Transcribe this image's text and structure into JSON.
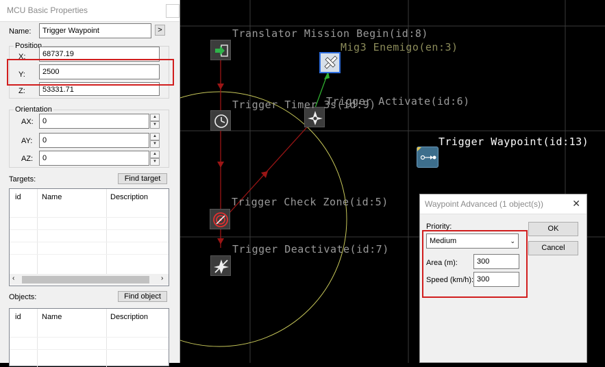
{
  "props_panel": {
    "title": "MCU Basic Properties",
    "name_label": "Name:",
    "name_value": "Trigger Waypoint",
    "name_more_button": ">",
    "position_group": "Position",
    "x_label": "X:",
    "x_value": "68737.19",
    "y_label": "Y:",
    "y_value": "2500",
    "z_label": "Z:",
    "z_value": "53331.71",
    "orientation_group": "Orientation",
    "ax_label": "AX:",
    "ax_value": "0",
    "ay_label": "AY:",
    "ay_value": "0",
    "az_label": "AZ:",
    "az_value": "0",
    "targets_label": "Targets:",
    "find_target_button": "Find target",
    "targets_columns": [
      "id",
      "Name",
      "Description"
    ],
    "objects_label": "Objects:",
    "find_object_button": "Find object",
    "objects_columns": [
      "id",
      "Name",
      "Description"
    ]
  },
  "canvas": {
    "labels": {
      "translator_begin": "Translator Mission Begin(id:8)",
      "mig3": "Mig3 Enemigo(en:3)",
      "trigger_timer": "Trigger Timer 3s(id:9)",
      "trigger_activate": "Trigger Activate(id:6)",
      "trigger_waypoint": "Trigger Waypoint(id:13)",
      "check_zone": "Trigger Check Zone(id:5)",
      "trigger_deactivate": "Trigger Deactivate(id:7)"
    },
    "colors": {
      "background": "#000000",
      "grid": "#3a3a3a",
      "link_red": "#9b1515",
      "link_green": "#2fae2f",
      "zone_circle": "#c8c85a",
      "selection": "#2f6fe0"
    }
  },
  "waypoint_dialog": {
    "title": "Waypoint Advanced (1 object(s))",
    "priority_label": "Priority:",
    "priority_value": "Medium",
    "area_label": "Area (m):",
    "area_value": "300",
    "speed_label": "Speed (km/h):",
    "speed_value": "300",
    "ok_button": "OK",
    "cancel_button": "Cancel"
  },
  "highlight_color": "#d11d1d"
}
